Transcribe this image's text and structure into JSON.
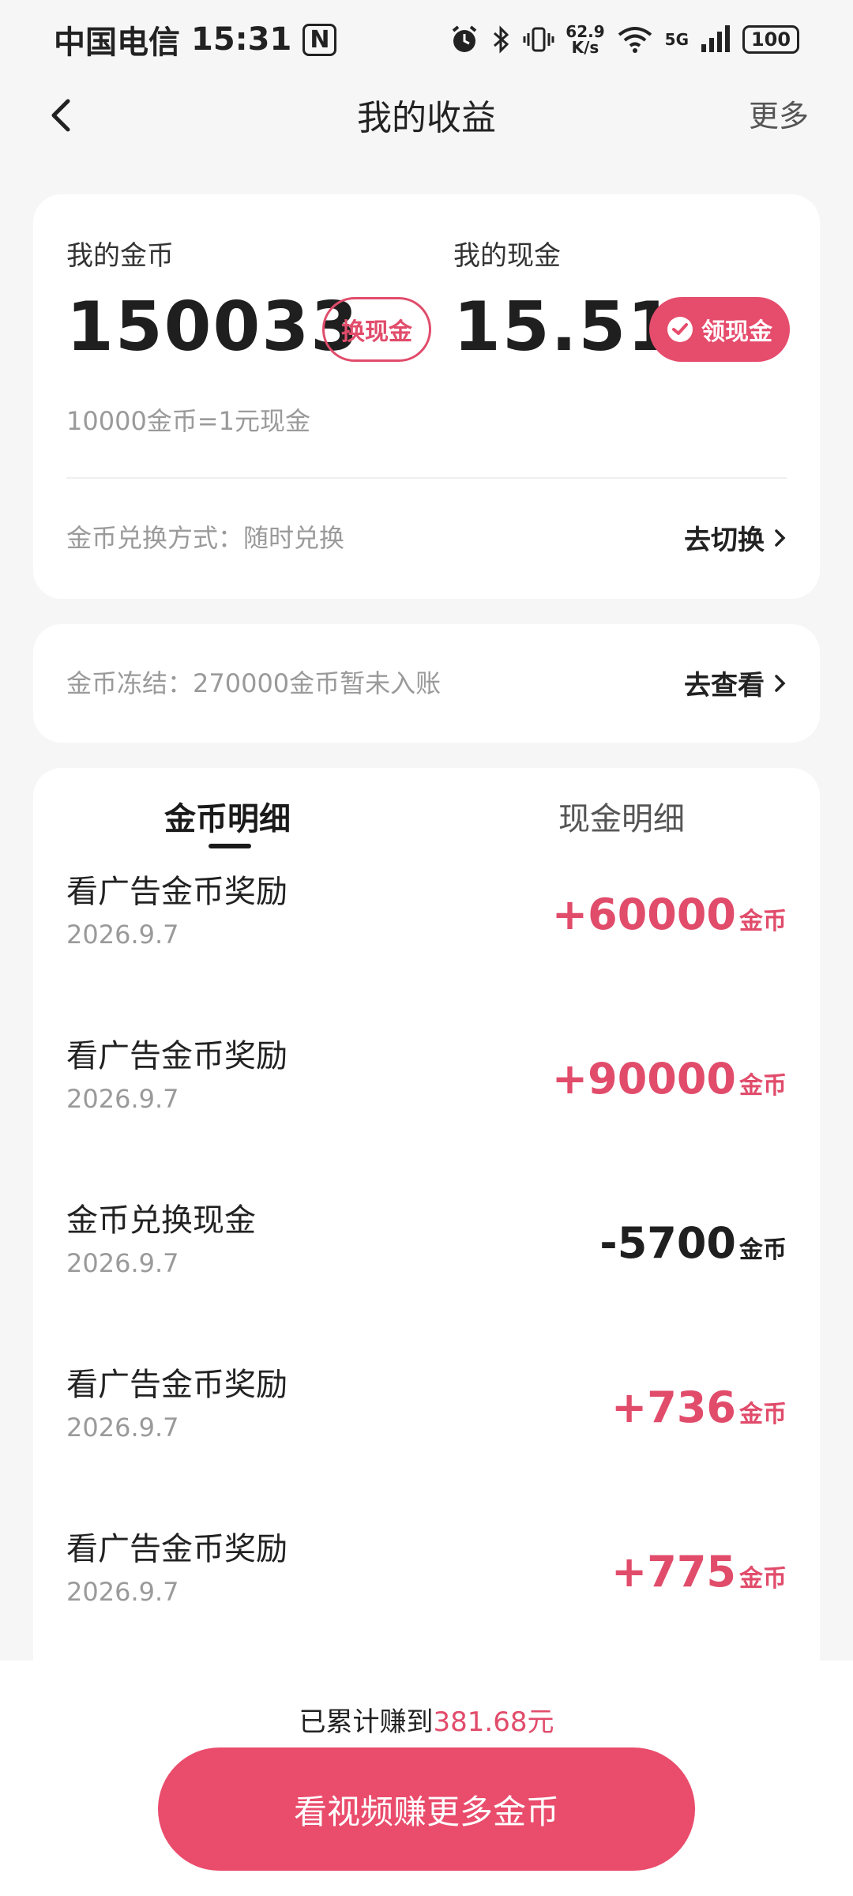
{
  "status_bar": {
    "carrier": "中国电信",
    "time": "15:31",
    "nfc": "N",
    "speed_value": "62.9",
    "speed_unit": "K/s",
    "network": "5G",
    "battery": "100"
  },
  "header": {
    "title": "我的收益",
    "more_label": "更多"
  },
  "balance": {
    "coins_label": "我的金币",
    "coins_value": "150033",
    "exchange_button": "换现金",
    "cash_label": "我的现金",
    "cash_value": "15.51",
    "withdraw_button": "领现金",
    "rate_text": "10000金币=1元现金",
    "method_text": "金币兑换方式：随时兑换",
    "switch_link": "去切换"
  },
  "frozen": {
    "text": "金币冻结：270000金币暂未入账",
    "view_link": "去查看"
  },
  "tabs": {
    "coin_detail": "金币明细",
    "cash_detail": "现金明细"
  },
  "transactions": [
    {
      "title": "看广告金币奖励",
      "date": "2026.9.7",
      "amount": "+60000",
      "unit": "金币"
    },
    {
      "title": "看广告金币奖励",
      "date": "2026.9.7",
      "amount": "+90000",
      "unit": "金币"
    },
    {
      "title": "金币兑换现金",
      "date": "2026.9.7",
      "amount": "-5700",
      "unit": "金币"
    },
    {
      "title": "看广告金币奖励",
      "date": "2026.9.7",
      "amount": "+736",
      "unit": "金币"
    },
    {
      "title": "看广告金币奖励",
      "date": "2026.9.7",
      "amount": "+775",
      "unit": "金币"
    }
  ],
  "footer": {
    "total_prefix": "已累计赚到",
    "total_amount": "381.68元",
    "cta_label": "看视频赚更多金币"
  },
  "colors": {
    "accent": "#e64c6c",
    "positive": "#e14c6b",
    "negative": "#1f1f1f"
  }
}
